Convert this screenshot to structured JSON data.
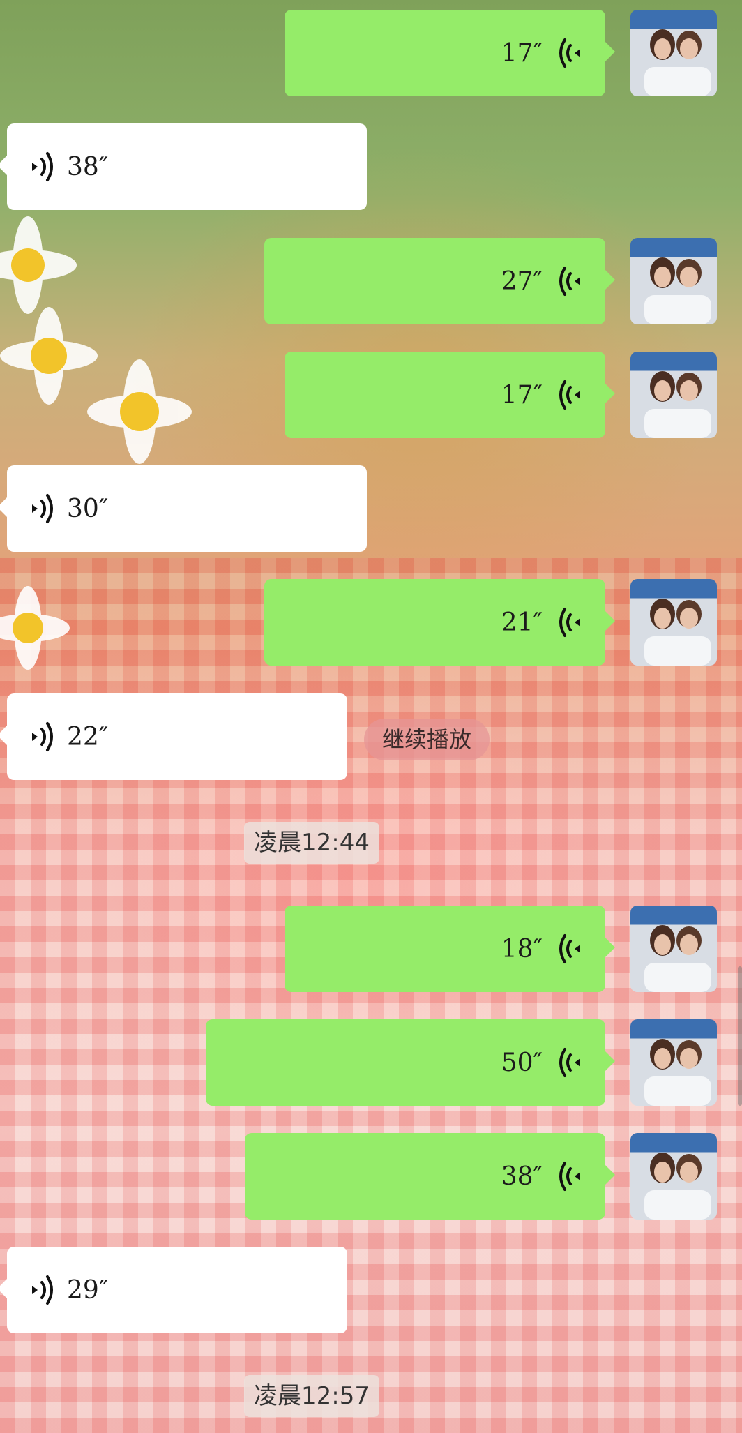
{
  "messages": [
    {
      "side": "out",
      "duration": "17″"
    },
    {
      "side": "in",
      "duration": "38″"
    },
    {
      "side": "out",
      "duration": "27″"
    },
    {
      "side": "out",
      "duration": "17″"
    },
    {
      "side": "in",
      "duration": "30″"
    },
    {
      "side": "out",
      "duration": "21″"
    },
    {
      "side": "in",
      "duration": "22″"
    },
    {
      "side": "out",
      "duration": "18″"
    },
    {
      "side": "out",
      "duration": "50″"
    },
    {
      "side": "out",
      "duration": "38″"
    },
    {
      "side": "in",
      "duration": "29″"
    }
  ],
  "timestamps": [
    "凌晨12:44",
    "凌晨12:57"
  ],
  "resume_playback_label": "继续播放",
  "colors": {
    "outgoing_bubble": "#95ec69",
    "incoming_bubble": "#ffffff"
  },
  "icons": {
    "voice": "voice-wave-icon",
    "avatar": "user-avatar"
  }
}
